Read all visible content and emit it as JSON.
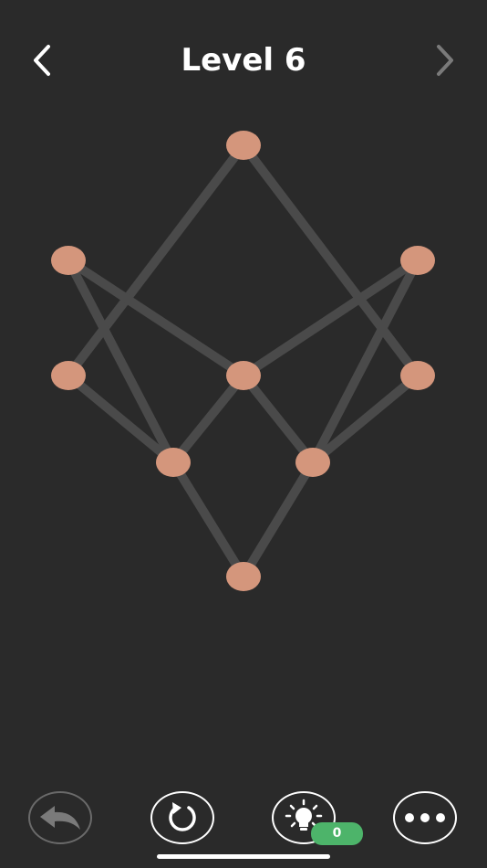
{
  "header": {
    "title": "Level 6",
    "back_icon": "chevron-left-icon",
    "next_icon": "chevron-right-icon"
  },
  "puzzle": {
    "node_color": "#d4967c",
    "edge_color": "#4a4a4a",
    "nodes": [
      {
        "id": "top",
        "col": 2,
        "row": 0
      },
      {
        "id": "upper-left",
        "col": 0,
        "row": 1
      },
      {
        "id": "upper-right",
        "col": 4,
        "row": 1
      },
      {
        "id": "mid-left",
        "col": 0,
        "row": 2
      },
      {
        "id": "center",
        "col": 2,
        "row": 2
      },
      {
        "id": "mid-right",
        "col": 4,
        "row": 2
      },
      {
        "id": "lower-left",
        "col": 1,
        "row": 3
      },
      {
        "id": "lower-right",
        "col": 3,
        "row": 3
      },
      {
        "id": "bottom",
        "col": 2,
        "row": 4
      }
    ],
    "edges": [
      [
        "top",
        "mid-left"
      ],
      [
        "top",
        "mid-right"
      ],
      [
        "upper-left",
        "center"
      ],
      [
        "upper-left",
        "lower-left"
      ],
      [
        "upper-right",
        "center"
      ],
      [
        "upper-right",
        "lower-right"
      ],
      [
        "mid-left",
        "lower-left"
      ],
      [
        "center",
        "lower-left"
      ],
      [
        "center",
        "lower-right"
      ],
      [
        "mid-right",
        "lower-right"
      ],
      [
        "lower-left",
        "bottom"
      ],
      [
        "lower-right",
        "bottom"
      ]
    ]
  },
  "toolbar": {
    "undo_icon": "undo-arrow-icon",
    "restart_icon": "restart-icon",
    "hint_icon": "lightbulb-icon",
    "more_icon": "more-dots-icon",
    "hint_count": "0",
    "hint_badge_color": "#4db46a"
  }
}
